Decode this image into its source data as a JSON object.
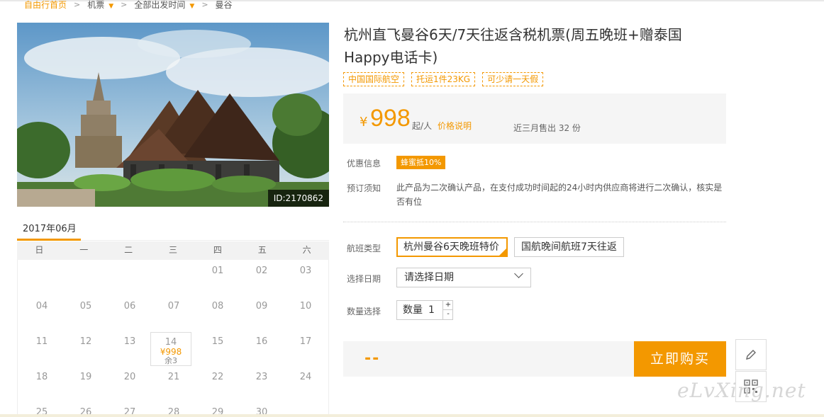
{
  "breadcrumb": {
    "home": "自由行首页",
    "items": [
      "机票",
      "全部出发时间",
      "曼谷"
    ]
  },
  "photo": {
    "id_label": "ID:2170862"
  },
  "calendar": {
    "month": "2017年06月",
    "weekdays": [
      "日",
      "一",
      "二",
      "三",
      "四",
      "五",
      "六"
    ],
    "days": [
      "01",
      "02",
      "03",
      "04",
      "05",
      "06",
      "07",
      "08",
      "09",
      "10",
      "11",
      "12",
      "13",
      "14",
      "15",
      "16",
      "17",
      "18",
      "19",
      "20",
      "21",
      "22",
      "23",
      "24",
      "25",
      "26",
      "27",
      "28",
      "29",
      "30"
    ],
    "selected": {
      "day": "14",
      "price": "¥998",
      "remain": "余3"
    }
  },
  "product": {
    "title": "杭州直飞曼谷6天/7天往返含税机票(周五晚班+赠泰国Happy电话卡)",
    "tags": [
      "中国国际航空",
      "托运1件23KG",
      "可少请一天假"
    ],
    "price": {
      "currency": "¥",
      "amount": "998",
      "unit": "起/人",
      "note": "价格说明",
      "sold": "近三月售出 32 份"
    },
    "promo": {
      "label": "优惠信息",
      "badge": "蜂蜜抵10%"
    },
    "notice": {
      "label": "预订须知",
      "text": "此产品为二次确认产品，在支付成功时间起的24小时内供应商将进行二次确认，核实是否有位"
    },
    "flight": {
      "label": "航班类型",
      "options": [
        "杭州曼谷6天晚班特价",
        "国航晚间航班7天往返"
      ]
    },
    "date": {
      "label": "选择日期",
      "placeholder": "请选择日期"
    },
    "qty": {
      "label": "数量选择",
      "inner_label": "数量",
      "value": "1",
      "plus": "+",
      "minus": "-"
    },
    "total": "--",
    "buy_label": "立即购买"
  },
  "watermark": "eLvXing.net",
  "colors": {
    "accent": "#f39800",
    "panel": "#f5f5f5"
  }
}
